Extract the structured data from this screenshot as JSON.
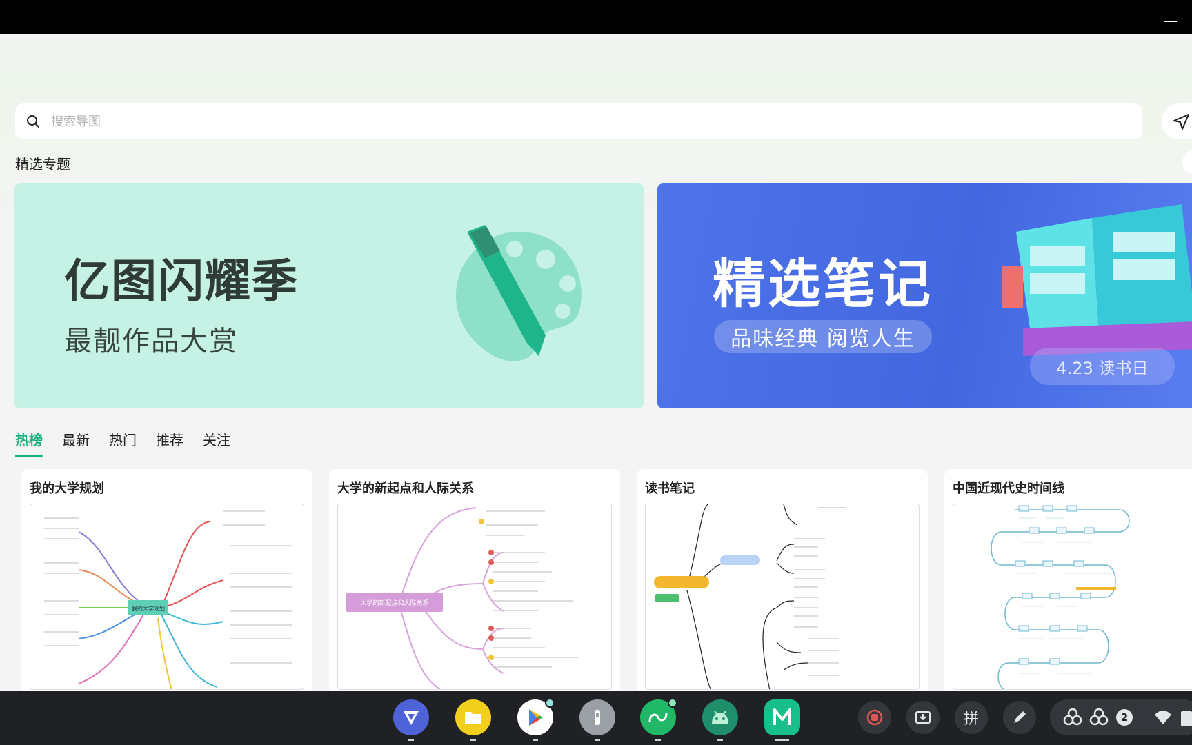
{
  "search": {
    "placeholder": "搜索导图"
  },
  "section": {
    "title": "精选专题"
  },
  "banners": [
    {
      "title": "亿图闪耀季",
      "subtitle": "最靓作品大赏",
      "bg": "#c6f1e5"
    },
    {
      "title": "精选笔记",
      "pill": "品味经典  阅览人生",
      "date": "4.23 读书日",
      "bg": "#4a6ee6"
    }
  ],
  "tabs": [
    {
      "label": "热榜",
      "active": true
    },
    {
      "label": "最新"
    },
    {
      "label": "热门"
    },
    {
      "label": "推荐"
    },
    {
      "label": "关注"
    }
  ],
  "cards": [
    {
      "title": "我的大学规划",
      "center": "我的大学规划"
    },
    {
      "title": "大学的新起点和人际关系",
      "center": "大学的新起点和人际关系"
    },
    {
      "title": "读书笔记"
    },
    {
      "title": "中国近现代史时间线"
    }
  ],
  "taskbar": {
    "apps": [
      "edraw-icon",
      "files-icon",
      "play-store-icon",
      "flashlight-icon",
      "loop-icon",
      "android-icon",
      "mindmaster-icon"
    ],
    "ime_label": "拼",
    "badge_count": "2"
  },
  "colors": {
    "accent": "#17b27f"
  }
}
